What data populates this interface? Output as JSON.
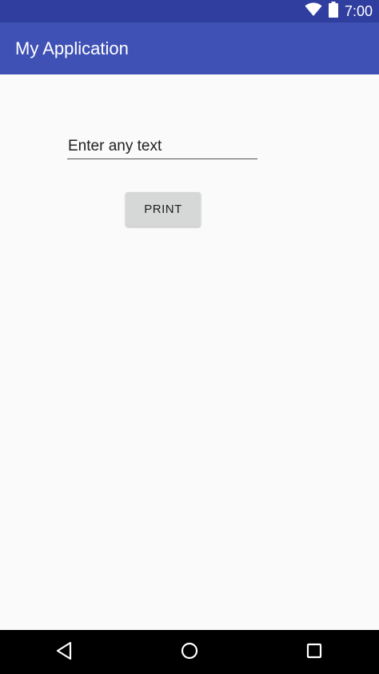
{
  "status_bar": {
    "time": "7:00",
    "icons": [
      "wifi-icon",
      "battery-icon"
    ]
  },
  "app_bar": {
    "title": "My Application"
  },
  "main": {
    "text_input": {
      "value": "",
      "placeholder": "Enter any text"
    },
    "print_button_label": "PRINT"
  },
  "nav_bar": {
    "icons": [
      "back-icon",
      "home-icon",
      "recents-icon"
    ]
  },
  "colors": {
    "status_bar": "#303f9f",
    "app_bar": "#3f51b5",
    "background": "#fafafa",
    "button": "#d6d7d7",
    "nav_bar": "#000000"
  }
}
